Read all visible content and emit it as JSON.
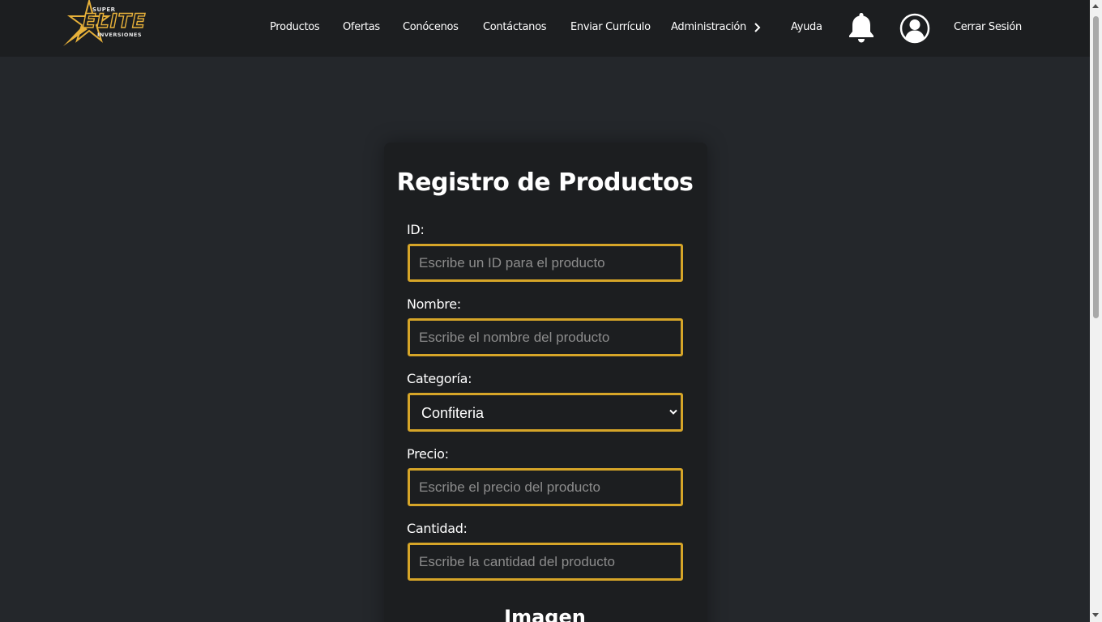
{
  "brand": {
    "super": "SUPER",
    "elite": "ELITE",
    "inversiones": "INVERSIONES"
  },
  "nav": {
    "items": [
      {
        "label": "Productos"
      },
      {
        "label": "Ofertas"
      },
      {
        "label": "Conócenos"
      },
      {
        "label": "Contáctanos"
      },
      {
        "label": "Enviar Currículo"
      },
      {
        "label": "Administración"
      },
      {
        "label": "Ayuda"
      }
    ],
    "logout": "Cerrar Sesión"
  },
  "form": {
    "title": "Registro de Productos",
    "id_label": "ID:",
    "id_placeholder": "Escribe un ID para el producto",
    "name_label": "Nombre:",
    "name_placeholder": "Escribe el nombre del producto",
    "category_label": "Categoría:",
    "category_value": "Confiteria",
    "price_label": "Precio:",
    "price_placeholder": "Escribe el precio del producto",
    "qty_label": "Cantidad:",
    "qty_placeholder": "Escribe la cantidad del producto",
    "image_section": "Imagen"
  },
  "colors": {
    "background": "#24272b",
    "navbar": "#1c1e20",
    "accent": "#d6a528"
  },
  "icons": {
    "bell": "bell-icon",
    "user": "user-icon",
    "chevron": "chevron-right-icon"
  }
}
